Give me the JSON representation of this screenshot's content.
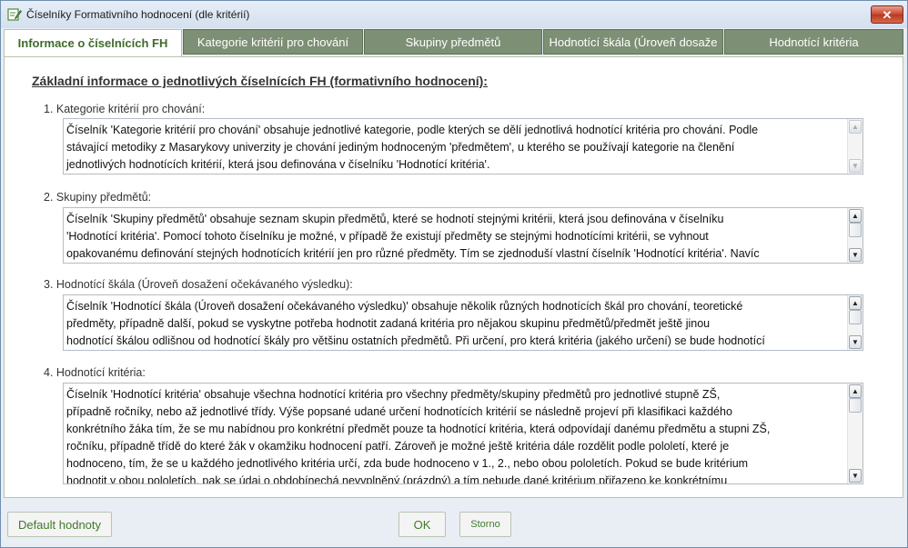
{
  "window": {
    "title": "Číselníky Formativního hodnocení (dle kritérií)",
    "close_label": "✕"
  },
  "tabs": [
    {
      "label": "Informace o  číselnících FH",
      "active": true
    },
    {
      "label": "Kategorie kritérií pro chování",
      "active": false
    },
    {
      "label": "Skupiny předmětů",
      "active": false
    },
    {
      "label": "Hodnotící škála (Úroveň dosaže",
      "active": false
    },
    {
      "label": "Hodnotící kritéria",
      "active": false
    }
  ],
  "panel": {
    "heading": "Základní informace o jednotlivých číselnících  FH (formativního hodnocení):",
    "sections": [
      {
        "label": "1. Kategorie kritérií pro  chování:",
        "text": "Číselník 'Kategorie kritérií pro chování' obsahuje jednotlivé kategorie, podle kterých se dělí jednotlivá hodnotící kritéria pro chování. Podle\nstávající metodiky z Masarykovy univerzity je chování jediným hodnoceným 'předmětem', u kterého se používají kategorie na členění\njednotlivých hodnotících kritérií, která jsou definována v číselníku 'Hodnotící kritéria'."
      },
      {
        "label": "2. Skupiny předmětů:",
        "text": "Číselník 'Skupiny předmětů' obsahuje seznam skupin předmětů, které se hodnotí stejnými kritérii, která jsou definována v číselníku\n'Hodnotící kritéria'. Pomocí tohoto číselníku je možné, v případě že existují předměty se stejnými hodnotícími kritérii, se vyhnout\nopakovanému definování stejných hodnotících kritérií jen pro různé předměty. Tím se zjednoduší vlastní číselník 'Hodnotící kritéria'. Navíc"
      },
      {
        "label": "3. Hodnotící škála (Úroveň dosažení očekávaného výsledku):",
        "text": "Číselník 'Hodnotící škála (Úroveň dosažení očekávaného výsledku)' obsahuje několik různých hodnotících škál pro chování, teoretické\npředměty, případně další, pokud se vyskytne potřeba hodnotit zadaná kritéria pro nějakou skupinu předmětů/předmět ještě jinou\nhodnotící škálou odlišnou od hodnotící škály pro většinu ostatních předmětů. Při určení, pro která kritéria (jakého určení) se bude hodnotící"
      },
      {
        "label": "4. Hodnotící kritéria:",
        "text": "Číselník 'Hodnotící kritéria' obsahuje všechna hodnotící kritéria pro všechny předměty/skupiny předmětů pro jednotlivé stupně ZŠ,\npřípadně ročníky, nebo až jednotlivé třídy. Výše popsané udané určení hodnotících kritérií se následně projeví při klasifikaci každého\nkonkrétního žáka tím, že se mu nabídnou pro konkrétní předmět pouze ta hodnotící kritéria, která odpovídají danému předmětu a stupni ZŠ,\nročníku, případně třídě do které žák v okamžiku hodnocení patří. Zároveň je možné ještě kritéria dále rozdělit podle pololetí, které je\nhodnoceno, tím, že se u každého jednotlivého kritéria určí, zda bude hodnoceno v 1., 2., nebo obou pololetích. Pokud se bude kritérium\nhodnotit v obou pololetích, pak se údaj o obdobínechá nevyplněný (prázdný) a tím nebude dané kritérium přiřazeno ke konkrétnímu"
      }
    ]
  },
  "buttons": {
    "default": "Default hodnoty",
    "ok": "OK",
    "cancel": "Storno"
  },
  "scroll_icons": {
    "up": "▲",
    "down": "▼"
  }
}
